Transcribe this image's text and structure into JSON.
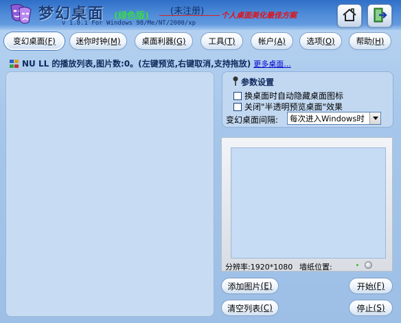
{
  "header": {
    "app_title": "梦幻桌面",
    "edition": "(绿色版)",
    "unregistered": "(未注册)",
    "version": "v 1.8.1   For Windows 98/Me/NT/2000/xp",
    "slogan": "个人桌面美化最佳方案",
    "icons": [
      "drama-mask-icon",
      "home-icon",
      "exit-door-icon"
    ]
  },
  "tabs": [
    {
      "label": "变幻桌面",
      "hotkey": "(F)"
    },
    {
      "label": "迷你时钟",
      "hotkey": "(M)"
    },
    {
      "label": "桌面利器",
      "hotkey": "(G)"
    },
    {
      "label": "工具",
      "hotkey": "(T)"
    },
    {
      "label": "帐户",
      "hotkey": "(A)"
    },
    {
      "label": "选项",
      "hotkey": "(O)"
    },
    {
      "label": "帮助",
      "hotkey": "(H)"
    }
  ],
  "playlist": {
    "info": "NU LL 的播放列表,图片数:0。(左键预览,右键取消,支持拖放)",
    "more_link": "更多桌面..."
  },
  "settings": {
    "title": "参数设置",
    "option_hide_icons": "换桌面时自动隐藏桌面图标",
    "option_close_effect": "关闭\"半透明预览桌面\"效果",
    "interval_label": "变幻桌面间隔:",
    "interval_value": "每次进入Windows时",
    "option_hide_icons_checked": false,
    "option_close_effect_checked": false
  },
  "preview": {
    "resolution": "分辨率:1920*1080",
    "wallpaper_position": "墙纸位置:"
  },
  "actions": {
    "add_image": "添加图片",
    "add_image_hotkey": "(E)",
    "clear_list": "清空列表",
    "clear_list_hotkey": "(C)",
    "start": "开始",
    "start_hotkey": "(F)",
    "stop": "停止",
    "stop_hotkey": "(S)"
  },
  "colors": {
    "header_blue": "#2f6fc7",
    "slogan_red": "#e0121a",
    "edition_green": "#39d94a",
    "panel_blue": "#c7dcf3",
    "link_blue": "#0000cc"
  }
}
